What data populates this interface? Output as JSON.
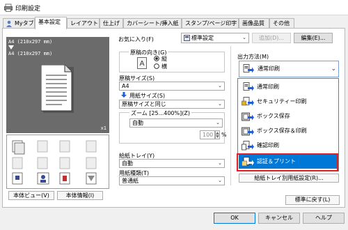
{
  "window": {
    "title": "印刷設定"
  },
  "tabs": [
    {
      "label": "Myタブ",
      "active": false
    },
    {
      "label": "基本設定",
      "active": true
    },
    {
      "label": "レイアウト",
      "active": false
    },
    {
      "label": "仕上げ",
      "active": false
    },
    {
      "label": "カバーシート/挿入紙",
      "active": false
    },
    {
      "label": "スタンプ/ページ印字",
      "active": false
    },
    {
      "label": "画像品質",
      "active": false
    },
    {
      "label": "その他",
      "active": false
    }
  ],
  "preview": {
    "line1": "A4 (210x297 mm)",
    "line2": "A4 (210x297 mm)",
    "copies": "x1"
  },
  "preview_buttons": {
    "view": "本体ビュー(V)",
    "info": "本体情報(I)"
  },
  "favorites": {
    "label": "お気に入り(F)",
    "value": "標準設定",
    "add_label": "追加(D)...",
    "edit_label": "編集(E)..."
  },
  "orientation": {
    "label": "原稿の向き(G)",
    "options": [
      "縦",
      "横"
    ],
    "selected": "縦"
  },
  "original_size": {
    "label": "原稿サイズ(S)",
    "value": "A4"
  },
  "paper_size": {
    "label": "用紙サイズ(S)",
    "value": "原稿サイズと同じ"
  },
  "zoom": {
    "label": "ズーム [25...400%](Z)",
    "value": "自動",
    "percent": "100",
    "unit": "%"
  },
  "paper_tray": {
    "label": "給紙トレイ(Y)",
    "value": "自動"
  },
  "paper_type": {
    "label": "用紙種類(T)",
    "value": "普通紙"
  },
  "output_method": {
    "label": "出力方法(M)",
    "value": "通常印刷",
    "options": [
      {
        "label": "通常印刷",
        "icon": "normal-print-icon"
      },
      {
        "label": "セキュリティー印刷",
        "icon": "secure-print-icon"
      },
      {
        "label": "ボックス保存",
        "icon": "box-save-icon"
      },
      {
        "label": "ボックス保存＆印刷",
        "icon": "box-save-print-icon"
      },
      {
        "label": "確認印刷",
        "icon": "proof-print-icon"
      },
      {
        "label": "認証＆プリント",
        "icon": "auth-print-icon",
        "highlighted": true
      }
    ]
  },
  "tray_settings_button": "給紙トレイ別用紙設定(R)...",
  "reset_button": "標準に戻す(L)",
  "footer": {
    "ok": "OK",
    "cancel": "キャンセル",
    "help": "ヘルプ"
  },
  "colors": {
    "selection": "#0078d7",
    "highlight_border": "#e02020",
    "preview_bg": "#6b6b6b"
  }
}
